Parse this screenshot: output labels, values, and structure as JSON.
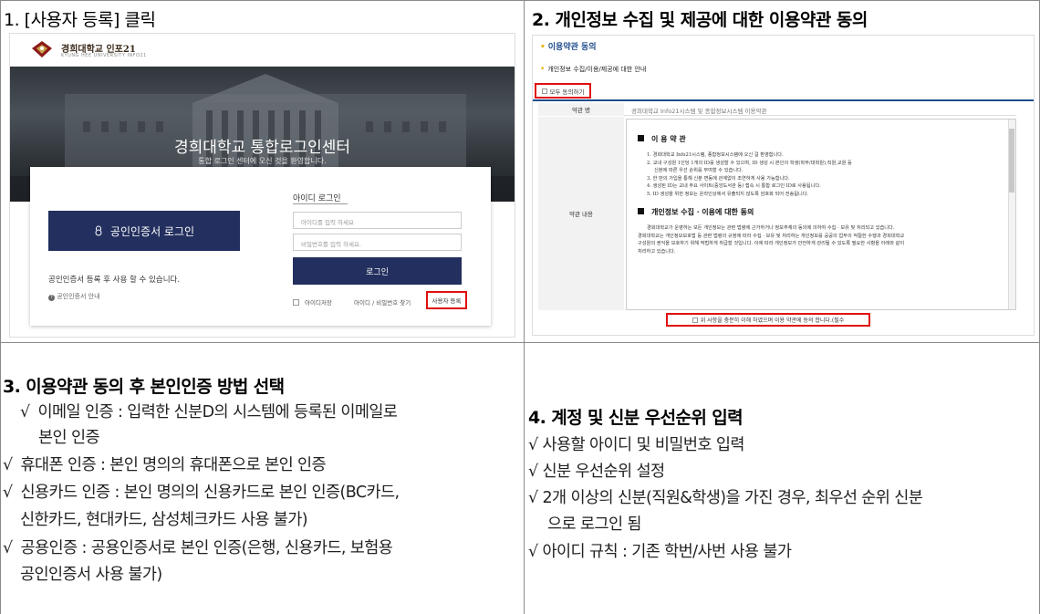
{
  "panel1": {
    "title": "1. [사용자 등록] 클릭",
    "screenshot": {
      "logo_text": "경희대학교 인포21",
      "logo_sub": "KYUNG HEE UNIVERSITY INFO21",
      "hero_title": "경희대학교 통합로그인센터",
      "hero_sub": "통합 로그인 센터에 오신 것을 환영합니다.",
      "cert_button": "공인인증서 로그인",
      "cert_note": "공인인증서 등록 후 사용 할 수 있습니다.",
      "cert_help": "공인인증서 안내",
      "id_tab": "아이디 로그인",
      "id_placeholder": "아이디를 입력 하세요",
      "pw_placeholder": "비밀번호를 입력 하세요.",
      "login_button": "로그인",
      "save_id": "아이디저장",
      "find_link": "아이디 / 비밀번호 찾기",
      "signup_link": "사용자 등록"
    }
  },
  "panel2": {
    "title": "2. 개인정보 수집 및 제공에 대한 이용약관 동의",
    "screenshot": {
      "heading": "이용약관 동의",
      "subheading": "개인정보 수집/이용/제공에 대한 안내",
      "agree_all": "모두 동의하기",
      "name_label": "약관 명",
      "name_value": "경희대학교 Info21시스템 및 종합정보시스템 이용약관",
      "content_label": "약관 내용",
      "section1": "이 용   약 관",
      "section1_lines": [
        "1. 경희대학교 Info21시스템, 종합정보시스템에 오신 걸 환영합니다.",
        "2. 교내 구성원 1인당 1개의 ID를 생성할 수 있으며, ID 생성 시 본인의 학생(학부/대학원),직원,교원 등",
        "신분에 따른 우선 순위를 부여할 수 있습니다.",
        "3. 한 번의 가입을 통해 신분 변동에 관계없이 조연하게 사용 가능합니다.",
        "4. 생성된 ID는 교내 주요 사이트(중앙도서관 등) 접속 시 통합 로그인 ID로 사용됩니다.",
        "5. ID 생성을 위한 정보는 온라인상에서 유출되지 않도록 암호화 되어 전송됩니다."
      ],
      "section2": "개인정보 수집  ·  이용에 대한 동의",
      "section2_lines": [
        "경희대학교가 운영하는 모든 개인정보는 관련 법령에 근거하거나 정보주체의 동의에 의하여 수집 · 보유 및 처리되고 있습니다.",
        "경희대학교는 개인정보보호법 등 관련 법령의 규정에 따라 수집 · 보유 및 처리하는 개인정보를 공공의 업무의 적절한 수행과 경희대학교",
        "구성원의 권익을 보호하기 위해 적법하게 취급할 것입니다. 이에 따라 개인정보가 안전하게 관리될 수 있도록 필요한 사항을 아래와 같이",
        "처리하고 있습니다."
      ],
      "consent": "위 사항을 충분히 이해 하였으며 이용 약관에 동의 합니다.(필수"
    }
  },
  "panel3": {
    "title": "3. 이용약관 동의 후 본인인증 방법 선택",
    "check": "√",
    "lines": [
      " 이메일 인증 : 입력한 신분D의 시스템에 등록된 이메일로",
      "본인 인증",
      " 휴대폰 인증 :  본인 명의의 휴대폰으로 본인 인증",
      " 신용카드 인증 : 본인 명의의 신용카드로 본인 인증(BC카드,",
      "신한카드, 현대카드, 삼성체크카드 사용 불가)",
      " 공용인증 : 공용인증서로 본인 인증(은행, 신용카드, 보험용",
      "공인인증서 사용 불가)"
    ]
  },
  "panel4": {
    "title": "4. 계정 및 신분 우선순위 입력",
    "lines": [
      "√  사용할 아이디 및 비밀번호 입력",
      "√  신분 우선순위 설정",
      "√ 2개 이상의 신분(직원&학생)을 가진 경우, 최우선 순위 신분",
      "으로 로그인 됨",
      "√  아이디 규칙 :  기존 학번/사번 사용 불가"
    ]
  }
}
